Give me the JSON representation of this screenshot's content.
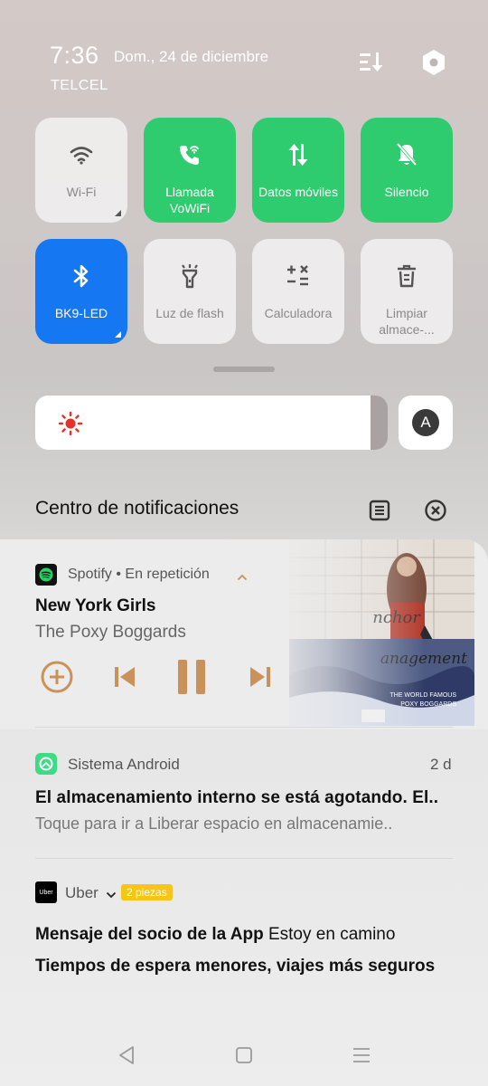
{
  "status": {
    "time": "7:36",
    "date": "Dom., 24 de diciembre",
    "carrier": "TELCEL"
  },
  "header_icons": [
    "edit-list-icon",
    "settings-icon"
  ],
  "tiles": [
    {
      "label": "Wi-Fi",
      "icon": "wifi-icon",
      "state": "off"
    },
    {
      "label": "Llamada VoWiFi",
      "icon": "wifi-call-icon",
      "state": "on"
    },
    {
      "label": "Datos móviles",
      "icon": "mobile-data-icon",
      "state": "on"
    },
    {
      "label": "Silencio",
      "icon": "bell-off-icon",
      "state": "on"
    },
    {
      "label": "BK9-LED",
      "icon": "bluetooth-icon",
      "state": "on"
    },
    {
      "label": "Luz de flash",
      "icon": "flashlight-icon",
      "state": "off"
    },
    {
      "label": "Calculadora",
      "icon": "calculator-icon",
      "state": "off"
    },
    {
      "label": "Limpiar almace-...",
      "icon": "trash-icon",
      "state": "off"
    }
  ],
  "brightness": {
    "level": 0.95,
    "auto_label": "A"
  },
  "notification_center": {
    "title": "Centro de notificaciones"
  },
  "media": {
    "app": "Spotify • En repetición",
    "title": "New York Girls",
    "artist": "The Poxy Boggards",
    "art_text_1": "nchor",
    "art_text_2": "anagement",
    "art_caption": "THE WORLD FAMOUS\nPOXY BOGGARDS",
    "controls": [
      "add-icon",
      "previous-icon",
      "pause-icon",
      "next-icon"
    ]
  },
  "android": {
    "app": "Sistema Android",
    "time": "2 d",
    "title": "El almacenamiento interno se está agotando. El..",
    "text": "Toque para ir a Liberar espacio en almacenamie.."
  },
  "uber": {
    "app": "Uber",
    "icon_text": "Uber",
    "badge": "2 piezas",
    "line1_bold": "Mensaje del socio de la App",
    "line1_rest": " Estoy en camino",
    "line2": "Tiempos de espera menores, viajes más seguros"
  },
  "colors": {
    "green": "#2fcc6f",
    "blue": "#1677f2",
    "media_accent": "#c9925a"
  }
}
